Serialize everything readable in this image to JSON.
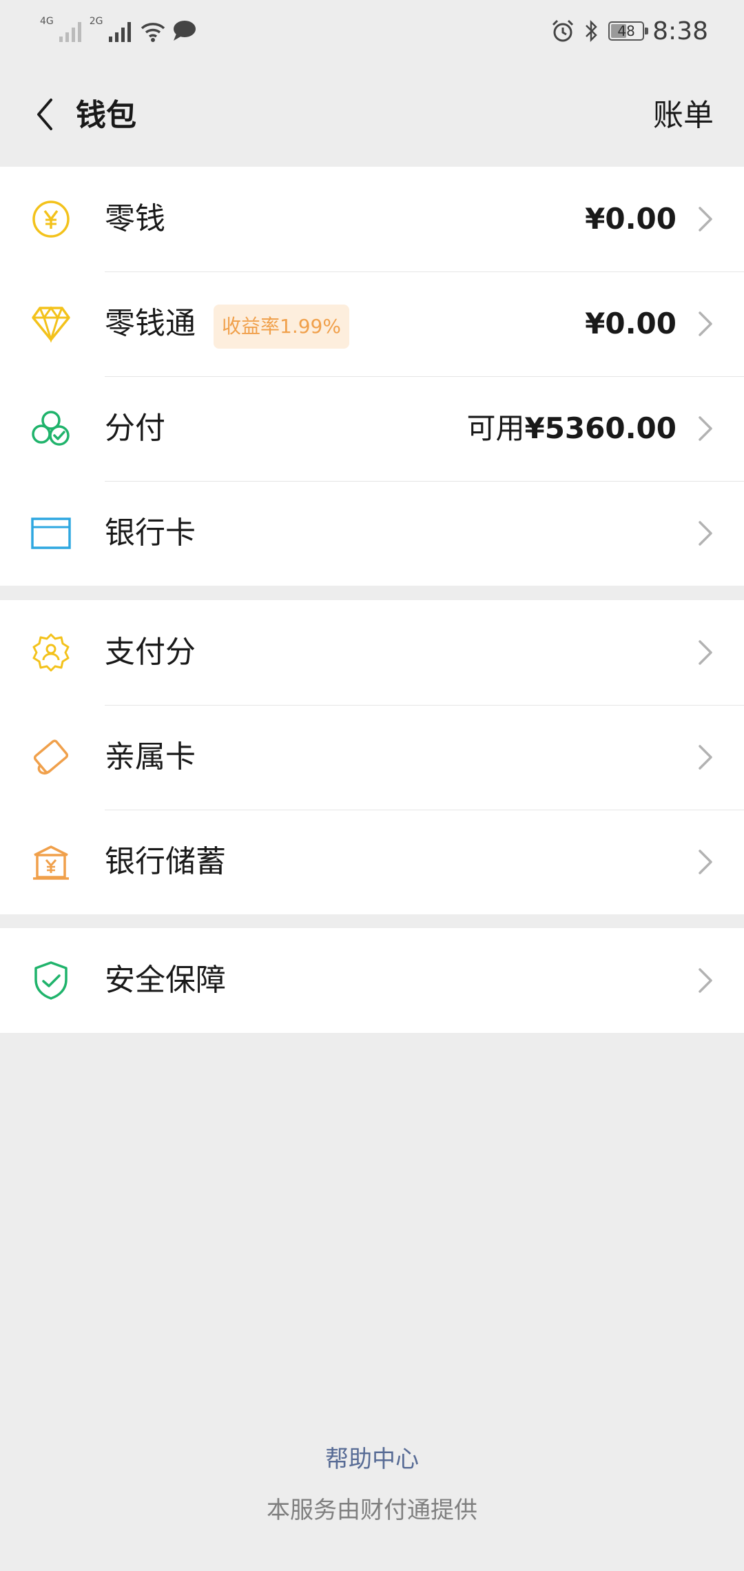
{
  "status_bar": {
    "net1": "4G",
    "net2": "2G",
    "battery": "48",
    "time": "8:38"
  },
  "nav": {
    "title": "钱包",
    "action": "账单"
  },
  "groups": [
    {
      "items": [
        {
          "label": "零钱",
          "value": "¥0.00",
          "icon": "yuan-coin-icon",
          "color": "#f3c21b"
        },
        {
          "label": "零钱通",
          "badge": "收益率1.99%",
          "value": "¥0.00",
          "icon": "diamond-icon",
          "color": "#f3c21b"
        },
        {
          "label": "分付",
          "value_prefix": "可用",
          "value": "¥5360.00",
          "icon": "fenfu-circles-icon",
          "color": "#1fb36b"
        },
        {
          "label": "银行卡",
          "icon": "bank-card-icon",
          "color": "#2ea7e0"
        }
      ]
    },
    {
      "items": [
        {
          "label": "支付分",
          "icon": "payscore-badge-icon",
          "color": "#f3c21b"
        },
        {
          "label": "亲属卡",
          "icon": "family-card-icon",
          "color": "#f0a04b"
        },
        {
          "label": "银行储蓄",
          "icon": "bank-deposit-icon",
          "color": "#f0a04b"
        }
      ]
    },
    {
      "items": [
        {
          "label": "安全保障",
          "icon": "security-shield-icon",
          "color": "#1fb36b"
        }
      ]
    }
  ],
  "footer": {
    "help": "帮助中心",
    "note": "本服务由财付通提供"
  }
}
